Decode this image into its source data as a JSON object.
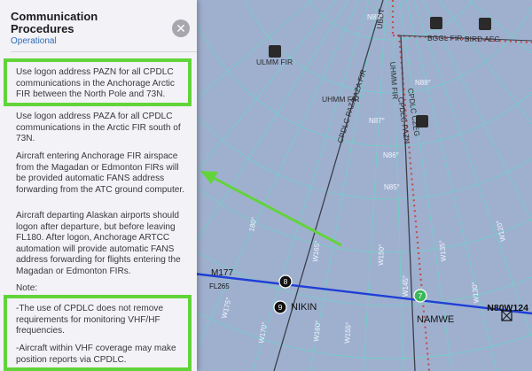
{
  "panel": {
    "title": "Communication Procedures",
    "subtitle": "Operational",
    "paragraphs": [
      "Use logon address PAZN for all CPDLC communications in the Anchorage Arctic FIR between the North Pole and 73N.",
      "Use logon address PAZA for all CPDLC communications in the Arctic FIR south of 73N.",
      "Aircraft entering Anchorage FIR airspace from the Magadan or Edmonton FIRs will be provided automatic FANS address forwarding from the ATC ground computer.",
      "Aircraft departing Alaskan airports should logon after departure, but before leaving FL180. After logon, Anchorage ARTCC automation will provide automatic FANS address forwarding for flights entering the Magadan or Edmonton FIRs."
    ],
    "note_label": "Note:",
    "notes": [
      "-The use of CPDLC does not remove requirements for monitoring VHF/HF frequencies.",
      "-Aircraft within VHF coverage may make position reports via CPDLC."
    ]
  },
  "colors": {
    "map_background": "#9fb0cf",
    "grid_line": "#6fd0c7",
    "route_line": "#1f3fd6",
    "highlight": "#62d43a",
    "fir_border": "#c0504d",
    "panel_background": "#f2f2f7"
  },
  "map": {
    "fir_labels": [
      "ULMM FIR",
      "UHMM FIR",
      "PAZA FIR",
      "BGGL FIR",
      "BIRD AEC",
      "CPDLC PAZN",
      "CPDLC CZEG",
      "CPDLC PAZA",
      "UHMM FIR",
      "UBDT"
    ],
    "latitudes": [
      "N89°",
      "N88°",
      "N87°",
      "N86°",
      "N85°"
    ],
    "longitudes": [
      "180°",
      "W165°",
      "W160°",
      "W155°",
      "W150°",
      "W145°",
      "W135°",
      "W130°",
      "W120°",
      "W170°",
      "W175°"
    ],
    "route": {
      "name": "M177",
      "level": "FL265"
    },
    "waypoints": [
      {
        "name": "NIKIN",
        "badge": "9"
      },
      {
        "name": "NAMWE",
        "badge": "7"
      },
      {
        "name": "N80W124",
        "badge": ""
      }
    ],
    "waypoint_badge_top": "8"
  }
}
